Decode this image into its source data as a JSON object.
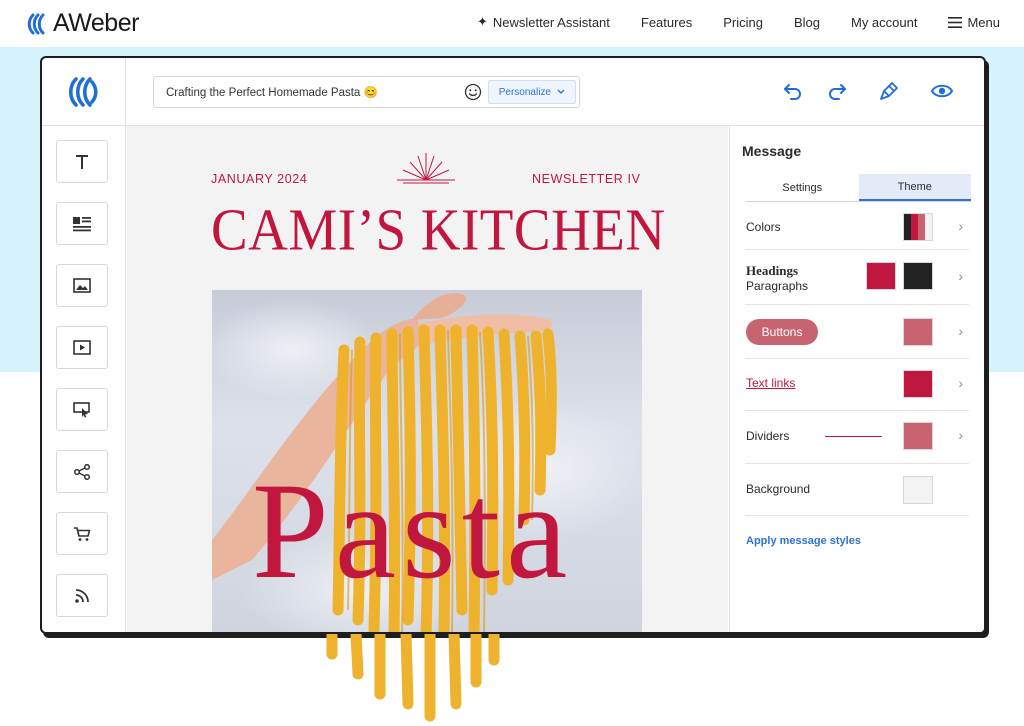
{
  "brand": {
    "name": "AWeber"
  },
  "nav": {
    "assistant": "Newsletter Assistant",
    "features": "Features",
    "pricing": "Pricing",
    "blog": "Blog",
    "account": "My account",
    "menu": "Menu"
  },
  "editor": {
    "subject": "Crafting the Perfect Homemade Pasta",
    "personalize": "Personalize"
  },
  "newsletter": {
    "date": "JANUARY 2024",
    "issue": "NEWSLETTER IV",
    "title": "CAMI’S KITCHEN",
    "hero_word": "Pasta"
  },
  "panel": {
    "title": "Message",
    "tabs": [
      "Settings",
      "Theme"
    ],
    "colors": "Colors",
    "headings": "Headings",
    "paragraphs": "Paragraphs",
    "buttons": "Buttons",
    "text_links": "Text links",
    "dividers": "Dividers",
    "background": "Background",
    "apply": "Apply message styles"
  },
  "theme_colors": {
    "accent": "#c1173f",
    "dark": "#222222",
    "muted": "#c86470",
    "background": "#f3f3f3",
    "link": "#2e72d2"
  }
}
